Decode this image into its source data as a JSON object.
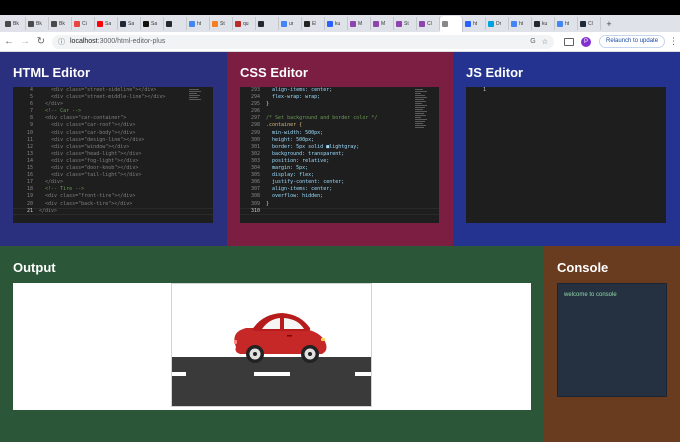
{
  "browser": {
    "tabs": [
      {
        "label": "Bk",
        "color": "#4a4a4a"
      },
      {
        "label": "Bk",
        "color": "#4a4a4a"
      },
      {
        "label": "Bk",
        "color": "#4a4a4a"
      },
      {
        "label": "Ci",
        "color": "#e8453c"
      },
      {
        "label": "Sa",
        "color": "#ff0000"
      },
      {
        "label": "Sa",
        "color": "#1f2937"
      },
      {
        "label": "Sa",
        "color": "#111111"
      },
      {
        "label": "",
        "color": "#24292f"
      },
      {
        "label": "ht",
        "color": "#4285f4"
      },
      {
        "label": "St",
        "color": "#f48024"
      },
      {
        "label": "qu",
        "color": "#b92b27"
      },
      {
        "label": "",
        "color": "#24292f"
      },
      {
        "label": "ur",
        "color": "#4285f4"
      },
      {
        "label": "El",
        "color": "#222222"
      },
      {
        "label": "ku",
        "color": "#2962ff"
      },
      {
        "label": "M",
        "color": "#8e44ad"
      },
      {
        "label": "M",
        "color": "#8e44ad"
      },
      {
        "label": "St",
        "color": "#8e44ad"
      },
      {
        "label": "Cl",
        "color": "#8e44ad"
      },
      {
        "label": "",
        "color": "#888888",
        "active": true
      },
      {
        "label": "ht",
        "color": "#2962ff"
      },
      {
        "label": "Dr",
        "color": "#00a3e0"
      },
      {
        "label": "ht",
        "color": "#4285f4"
      },
      {
        "label": "ku",
        "color": "#24292f"
      },
      {
        "label": "ht",
        "color": "#4285f4"
      },
      {
        "label": "Cl",
        "color": "#1f2937"
      }
    ],
    "new_tab_symbol": "+",
    "url_host": "localhost",
    "url_path": ":3000/html-editor-plus",
    "relaunch_label": "Relaunch to update",
    "avatar_letter": "P"
  },
  "panels": {
    "html": {
      "title": "HTML Editor",
      "lines": [
        {
          "n": "4",
          "code": "    <div class=\"street-sideline\"></div>"
        },
        {
          "n": "5",
          "code": "    <div class=\"street-middle-line\"></div>"
        },
        {
          "n": "6",
          "code": "  </div>"
        },
        {
          "n": "7",
          "code": "  <!-- Car -->"
        },
        {
          "n": "8",
          "code": "  <div class=\"car-container\">"
        },
        {
          "n": "9",
          "code": "    <div class=\"car-roof\"></div>"
        },
        {
          "n": "10",
          "code": "    <div class=\"car-body\"></div>"
        },
        {
          "n": "11",
          "code": "    <div class=\"design-line\"></div>"
        },
        {
          "n": "12",
          "code": "    <div class=\"window\"></div>"
        },
        {
          "n": "13",
          "code": "    <div class=\"head-light\"></div>"
        },
        {
          "n": "14",
          "code": "    <div class=\"fog-light\"></div>"
        },
        {
          "n": "15",
          "code": "    <div class=\"door-knob\"></div>"
        },
        {
          "n": "16",
          "code": "    <div class=\"tail-light\"></div>"
        },
        {
          "n": "17",
          "code": "  </div>"
        },
        {
          "n": "18",
          "code": "  <!-- Tire -->"
        },
        {
          "n": "19",
          "code": "  <div class=\"front-tire\"></div>"
        },
        {
          "n": "20",
          "code": "  <div class=\"back-tire\"></div>"
        },
        {
          "n": "21",
          "code": "</div>"
        }
      ]
    },
    "css": {
      "title": "CSS Editor",
      "lines": [
        {
          "n": "293",
          "code": "  align-items: center;"
        },
        {
          "n": "294",
          "code": "  flex-wrap: wrap;"
        },
        {
          "n": "295",
          "code": "}"
        },
        {
          "n": "296",
          "code": ""
        },
        {
          "n": "297",
          "code": "/* Set background and border color */"
        },
        {
          "n": "298",
          "code": ".container {"
        },
        {
          "n": "299",
          "code": "  min-width: 500px;"
        },
        {
          "n": "300",
          "code": "  height: 500px;"
        },
        {
          "n": "301",
          "code": "  border: 5px solid ■lightgray;"
        },
        {
          "n": "302",
          "code": "  background: transparent;"
        },
        {
          "n": "303",
          "code": "  position: relative;"
        },
        {
          "n": "304",
          "code": "  margin: 5px;"
        },
        {
          "n": "305",
          "code": "  display: flex;"
        },
        {
          "n": "306",
          "code": "  justify-content: center;"
        },
        {
          "n": "307",
          "code": "  align-items: center;"
        },
        {
          "n": "308",
          "code": "  overflow: hidden;"
        },
        {
          "n": "309",
          "code": "}"
        },
        {
          "n": "310",
          "code": ""
        }
      ]
    },
    "js": {
      "title": "JS Editor",
      "lines": [
        {
          "n": "1",
          "code": ""
        }
      ]
    },
    "output": {
      "title": "Output"
    },
    "console": {
      "title": "Console",
      "message": "welcome to console"
    }
  },
  "colors": {
    "html_panel": "#2a2f7e",
    "css_panel": "#7b1e42",
    "js_panel": "#23338f",
    "output_panel": "#2b5638",
    "console_panel": "#6a3c1f",
    "car_body": "#c62828",
    "road": "#3a3a3a"
  }
}
